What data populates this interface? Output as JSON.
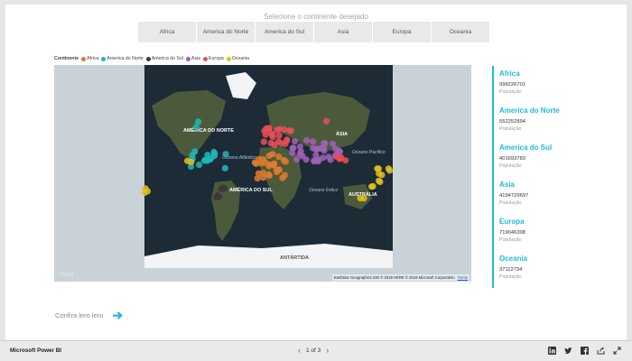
{
  "slicer": {
    "title": "Selecione o continente desejado",
    "options": [
      "Africa",
      "America do Norte",
      "America do Sul",
      "Asia",
      "Europa",
      "Oceania"
    ]
  },
  "legend": {
    "title": "Continente",
    "items": [
      {
        "label": "Africa",
        "color": "#e07b2e"
      },
      {
        "label": "America do Norte",
        "color": "#1fb9b5"
      },
      {
        "label": "America do Sul",
        "color": "#3a3a3a"
      },
      {
        "label": "Asia",
        "color": "#a062b8"
      },
      {
        "label": "Europa",
        "color": "#ea4f57"
      },
      {
        "label": "Oceania",
        "color": "#e3c020"
      }
    ]
  },
  "map": {
    "labels": {
      "north_america": "AMÉRICA DO NORTE",
      "south_america": "AMÉRICA DO SUL",
      "atlantic": "Oceano Atlântico",
      "asia": "ÁSIA",
      "pacific": "Oceano Pacífico",
      "indian": "Oceano Índico",
      "australia": "AUSTRÁLIA",
      "antarctica": "ANTÁRTIDA"
    },
    "bing": "Bing",
    "attribution": "Earthstar Geographics SIO  © 2019 HERE  © 2019 Microsoft Corporation",
    "terms": "Terms"
  },
  "cards": [
    {
      "name": "Africa",
      "value": "998226701",
      "label": "População"
    },
    {
      "name": "America do Norte",
      "value": "552252894",
      "label": "População"
    },
    {
      "name": "America do Sul",
      "value": "401693783",
      "label": "População"
    },
    {
      "name": "Asia",
      "value": "4194729697",
      "label": "População"
    },
    {
      "name": "Europa",
      "value": "719046308",
      "label": "População"
    },
    {
      "name": "Oceania",
      "value": "37112734",
      "label": "População"
    }
  ],
  "link": {
    "text": "Confira lero lero"
  },
  "footer": {
    "brand": "Microsoft Power BI",
    "page_indicator": "1 of 3"
  },
  "colors": {
    "accent": "#1fb9dc",
    "map_ocean": "#1a2a35",
    "map_land": "#4c5a3c",
    "ice": "#f2f4f6"
  }
}
